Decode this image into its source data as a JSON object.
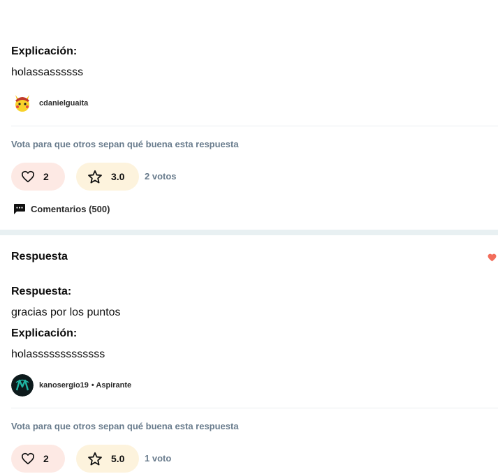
{
  "answer1": {
    "explanation_label": "Explicación:",
    "explanation_text": "holassassssss",
    "author": "cdanielguaita",
    "vote_hint": "Vota para que otros sepan qué buena esta respuesta",
    "likes": "2",
    "rating": "3.0",
    "votes": "2 votos",
    "comments": "Comentarios (500)"
  },
  "answer2": {
    "title": "Respuesta",
    "answer_label": "Respuesta:",
    "answer_text": "gracias por los puntos",
    "explanation_label": "Explicación:",
    "explanation_text": "holasssssssssssss",
    "author": "kanosergio19",
    "author_rank": "• Aspirante",
    "vote_hint": "Vota para que otros sepan qué buena esta respuesta",
    "likes": "2",
    "rating": "5.0",
    "votes": "1 voto"
  },
  "colors": {
    "heart_pill": "#fde9e4",
    "star_pill": "#fdf3dd",
    "muted_text": "#687b8c",
    "badge_heart": "#f26d5b",
    "section_gap": "#e8f0f2"
  }
}
